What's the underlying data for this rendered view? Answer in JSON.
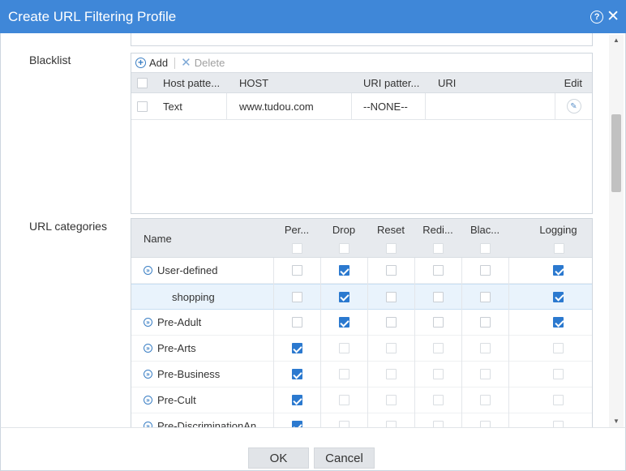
{
  "dialog": {
    "title": "Create URL Filtering Profile",
    "help_glyph": "?",
    "close_glyph": "✕"
  },
  "blacklist": {
    "label": "Blacklist",
    "toolbar": {
      "add_label": "Add",
      "delete_label": "Delete"
    },
    "columns": [
      "Host patte...",
      "HOST",
      "URI patter...",
      "URI",
      "Edit"
    ],
    "rows": [
      {
        "host_pattern": "Text",
        "host": "www.tudou.com",
        "uri_pattern": "--NONE--",
        "uri": "",
        "checked": false
      }
    ]
  },
  "url_categories": {
    "label": "URL categories",
    "columns": [
      "Name",
      "Per...",
      "Drop",
      "Reset",
      "Redi...",
      "Blac...",
      "Logging"
    ],
    "rows": [
      {
        "name": "User-defined",
        "level": 0,
        "expandable": true,
        "selected": false,
        "checks": [
          false,
          true,
          false,
          false,
          false,
          true
        ],
        "dim": [
          false,
          false,
          false,
          false,
          false,
          false
        ]
      },
      {
        "name": "shopping",
        "level": 1,
        "expandable": false,
        "selected": true,
        "checks": [
          false,
          true,
          false,
          false,
          false,
          true
        ],
        "dim": [
          false,
          false,
          false,
          false,
          false,
          false
        ]
      },
      {
        "name": "Pre-Adult",
        "level": 0,
        "expandable": true,
        "selected": false,
        "checks": [
          false,
          true,
          false,
          false,
          false,
          true
        ],
        "dim": [
          false,
          false,
          false,
          false,
          false,
          false
        ]
      },
      {
        "name": "Pre-Arts",
        "level": 0,
        "expandable": true,
        "selected": false,
        "checks": [
          true,
          false,
          false,
          false,
          false,
          false
        ],
        "dim": [
          false,
          true,
          true,
          true,
          true,
          true
        ]
      },
      {
        "name": "Pre-Business",
        "level": 0,
        "expandable": true,
        "selected": false,
        "checks": [
          true,
          false,
          false,
          false,
          false,
          false
        ],
        "dim": [
          false,
          true,
          true,
          true,
          true,
          true
        ]
      },
      {
        "name": "Pre-Cult",
        "level": 0,
        "expandable": true,
        "selected": false,
        "checks": [
          true,
          false,
          false,
          false,
          false,
          false
        ],
        "dim": [
          false,
          true,
          true,
          true,
          true,
          true
        ]
      },
      {
        "name": "Pre-DiscriminationAn...",
        "level": 0,
        "expandable": true,
        "selected": false,
        "checks": [
          true,
          false,
          false,
          false,
          false,
          false
        ],
        "dim": [
          false,
          true,
          true,
          true,
          true,
          true
        ]
      }
    ]
  },
  "footer": {
    "ok_label": "OK",
    "cancel_label": "Cancel"
  },
  "colors": {
    "titlebar": "#3f87d8",
    "accent": "#2b79cf",
    "header_bg": "#e7eaee",
    "selected_row": "#e9f3fc"
  }
}
